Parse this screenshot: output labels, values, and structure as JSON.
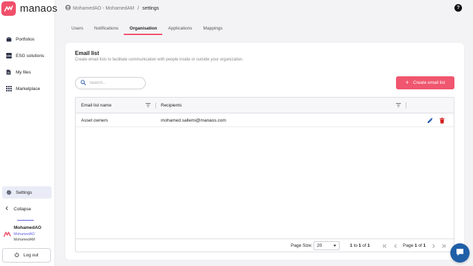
{
  "app": {
    "logo_text": "manaos",
    "brand_color": "#f0506a"
  },
  "sidebar": {
    "items": [
      {
        "label": "Portfolios",
        "icon": "briefcase-icon"
      },
      {
        "label": "ESG solutions",
        "icon": "esg-icon"
      },
      {
        "label": "My files",
        "icon": "file-icon"
      },
      {
        "label": "Marketplace",
        "icon": "grid-icon"
      }
    ],
    "settings_label": "Settings",
    "collapse_label": "Collapse",
    "user": {
      "name": "MohamedAO",
      "line1": "MohamedAO",
      "line2": "MohamedAM"
    },
    "logout_label": "Log out"
  },
  "header": {
    "breadcrumb_user": "MohamedAO - MohamedAM",
    "breadcrumb_sep": "/",
    "breadcrumb_current": "settings",
    "help_label": "?"
  },
  "tabs": [
    {
      "label": "Users",
      "active": false
    },
    {
      "label": "Notifications",
      "active": false
    },
    {
      "label": "Organisation",
      "active": true
    },
    {
      "label": "Applications",
      "active": false
    },
    {
      "label": "Mappings",
      "active": false
    }
  ],
  "card": {
    "title": "Email list",
    "description": "Create email lists to facilitate communication with people inside or outside your organization.",
    "search_placeholder": "Search...",
    "create_button": "Create email list"
  },
  "grid": {
    "columns": [
      "Email list name",
      "Recipients"
    ],
    "rows": [
      {
        "name": "Asset owners",
        "recipients": "mohamed.sallemi@manaos.com"
      }
    ],
    "footer": {
      "page_size_label": "Page Size:",
      "page_size_value": "20",
      "range_start": "1",
      "range_to": "to",
      "range_end": "1",
      "range_of": "of",
      "range_total": "1",
      "page_label": "Page",
      "page_current": "1",
      "page_of": "of",
      "page_total": "1"
    }
  }
}
